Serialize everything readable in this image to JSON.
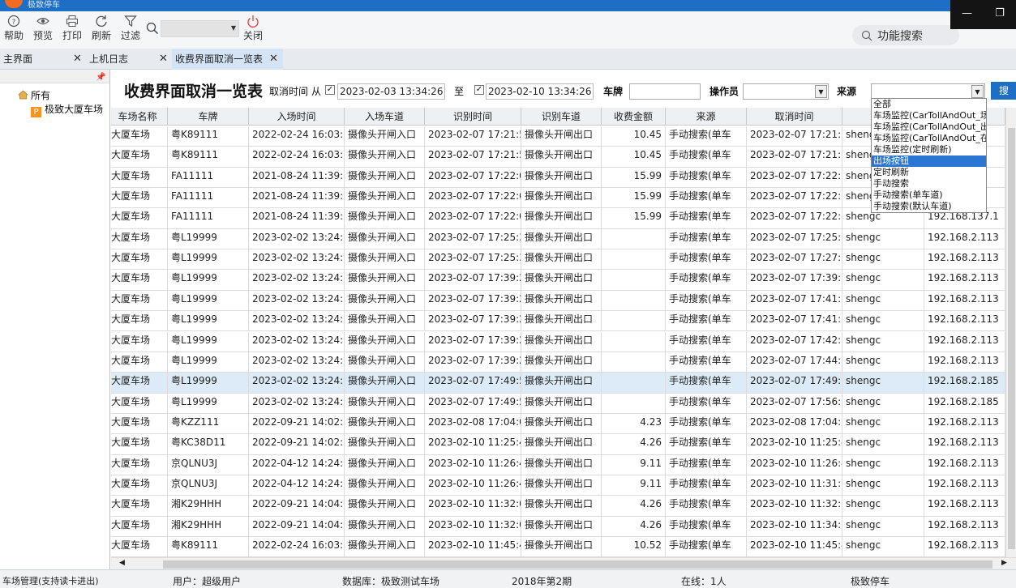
{
  "window": {
    "title": "极致停车"
  },
  "toolbar": {
    "help": "帮助",
    "preview": "预览",
    "print": "打印",
    "refresh": "刷新",
    "filter": "过滤",
    "close": "关闭",
    "function_search": "功能搜索"
  },
  "tabs": [
    {
      "label": "主界面"
    },
    {
      "label": "上机日志"
    },
    {
      "label": "收费界面取消一览表"
    }
  ],
  "tree": {
    "root": "所有",
    "child": "极致大厦车场"
  },
  "page_title": "收费界面取消一览表",
  "filters": {
    "cancel_time_label": "取消时间",
    "from_label": "从",
    "from_value": "2023-02-03 13:34:26",
    "to_label": "至",
    "to_value": "2023-02-10 13:34:26",
    "plate_label": "车牌",
    "operator_label": "操作员",
    "source_label": "来源",
    "query_button": "搜"
  },
  "columns": [
    "车场名称",
    "车牌",
    "入场时间",
    "入场车道",
    "识别时间",
    "识别车道",
    "收费金额",
    "来源",
    "取消时间",
    "",
    ""
  ],
  "rows": [
    [
      "大厦车场",
      "粤K89111",
      "2022-02-24 16:03:5",
      "摄像头开闸入口",
      "2023-02-07 17:21:5",
      "摄像头开闸出口",
      "10.45",
      "手动搜索(单车",
      "2023-02-07 17:21:5",
      "shengc",
      "1"
    ],
    [
      "大厦车场",
      "粤K89111",
      "2022-02-24 16:03:5",
      "摄像头开闸入口",
      "2023-02-07 17:21:5",
      "摄像头开闸出口",
      "10.45",
      "手动搜索(单车",
      "2023-02-07 17:21:5",
      "shengc",
      "1"
    ],
    [
      "大厦车场",
      "FA11111",
      "2021-08-24 11:39:0",
      "摄像头开闸入口",
      "2023-02-07 17:22:0",
      "摄像头开闸出口",
      "15.99",
      "手动搜索(单车",
      "2023-02-07 17:22:0",
      "shengc",
      "1"
    ],
    [
      "大厦车场",
      "FA11111",
      "2021-08-24 11:39:0",
      "摄像头开闸入口",
      "2023-02-07 17:22:0",
      "摄像头开闸出口",
      "15.99",
      "手动搜索(单车",
      "2023-02-07 17:22:0",
      "shengc",
      "1"
    ],
    [
      "大厦车场",
      "FA11111",
      "2021-08-24 11:39:0",
      "摄像头开闸入口",
      "2023-02-07 17:22:0",
      "摄像头开闸出口",
      "15.99",
      "手动搜索(单车",
      "2023-02-07 17:22:0",
      "shengc",
      "192.168.137.1"
    ],
    [
      "大厦车场",
      "粤L19999",
      "2023-02-02 13:24:2",
      "摄像头开闸入口",
      "2023-02-07 17:25:3",
      "摄像头开闸出口",
      "",
      "手动搜索(单车",
      "2023-02-07 17:25:3",
      "shengc",
      "192.168.2.113"
    ],
    [
      "大厦车场",
      "粤L19999",
      "2023-02-02 13:24:2",
      "摄像头开闸入口",
      "2023-02-07 17:25:3",
      "摄像头开闸出口",
      "",
      "手动搜索(单车",
      "2023-02-07 17:27:2",
      "shengc",
      "192.168.2.113"
    ],
    [
      "大厦车场",
      "粤L19999",
      "2023-02-02 13:24:2",
      "摄像头开闸入口",
      "2023-02-07 17:39:2",
      "摄像头开闸出口",
      "",
      "手动搜索(单车",
      "2023-02-07 17:39:2",
      "shengc",
      "192.168.2.113"
    ],
    [
      "大厦车场",
      "粤L19999",
      "2023-02-02 13:24:2",
      "摄像头开闸入口",
      "2023-02-07 17:39:2",
      "摄像头开闸出口",
      "",
      "手动搜索(单车",
      "2023-02-07 17:41:1",
      "shengc",
      "192.168.2.113"
    ],
    [
      "大厦车场",
      "粤L19999",
      "2023-02-02 13:24:2",
      "摄像头开闸入口",
      "2023-02-07 17:39:2",
      "摄像头开闸出口",
      "",
      "手动搜索(单车",
      "2023-02-07 17:41:1",
      "shengc",
      "192.168.2.113"
    ],
    [
      "大厦车场",
      "粤L19999",
      "2023-02-02 13:24:2",
      "摄像头开闸入口",
      "2023-02-07 17:39:2",
      "摄像头开闸出口",
      "",
      "手动搜索(单车",
      "2023-02-07 17:42:2",
      "shengc",
      "192.168.2.113"
    ],
    [
      "大厦车场",
      "粤L19999",
      "2023-02-02 13:24:2",
      "摄像头开闸入口",
      "2023-02-07 17:39:2",
      "摄像头开闸出口",
      "",
      "手动搜索(单车",
      "2023-02-07 17:44:1",
      "shengc",
      "192.168.2.113"
    ],
    [
      "大厦车场",
      "粤L19999",
      "2023-02-02 13:24:2",
      "摄像头开闸入口",
      "2023-02-07 17:49:5",
      "摄像头开闸出口",
      "",
      "手动搜索(单车",
      "2023-02-07 17:49:5",
      "shengc",
      "192.168.2.185"
    ],
    [
      "大厦车场",
      "粤L19999",
      "2023-02-02 13:24:2",
      "摄像头开闸入口",
      "2023-02-07 17:49:5",
      "摄像头开闸出口",
      "",
      "手动搜索(单车",
      "2023-02-07 17:56:1",
      "shengc",
      "192.168.2.185"
    ],
    [
      "大厦车场",
      "粤KZZ111",
      "2022-09-21 14:02:3",
      "摄像头开闸入口",
      "2023-02-08 17:04:0",
      "摄像头开闸出口",
      "4.23",
      "手动搜索(单车",
      "2023-02-08 17:04:0",
      "shengc",
      "192.168.2.113"
    ],
    [
      "大厦车场",
      "粤KC38D11",
      "2022-09-21 14:02:3",
      "摄像头开闸入口",
      "2023-02-10 11:25:4",
      "摄像头开闸出口",
      "4.26",
      "手动搜索(单车",
      "2023-02-10 11:25:4",
      "shengc",
      "192.168.2.113"
    ],
    [
      "大厦车场",
      "京QLNU3J",
      "2022-04-12 14:24:5",
      "摄像头开闸入口",
      "2023-02-10 11:26:4",
      "摄像头开闸出口",
      "9.11",
      "手动搜索(单车",
      "2023-02-10 11:26:4",
      "shengc",
      "192.168.2.113"
    ],
    [
      "大厦车场",
      "京QLNU3J",
      "2022-04-12 14:24:5",
      "摄像头开闸入口",
      "2023-02-10 11:26:4",
      "摄像头开闸出口",
      "9.11",
      "手动搜索(单车",
      "2023-02-10 11:31:1",
      "shengc",
      "192.168.2.113"
    ],
    [
      "大厦车场",
      "湘K29HHH",
      "2022-09-21 14:04:0",
      "摄像头开闸入口",
      "2023-02-10 11:32:0",
      "摄像头开闸出口",
      "4.26",
      "手动搜索(单车",
      "2023-02-10 11:32:0",
      "shengc",
      "192.168.2.113"
    ],
    [
      "大厦车场",
      "湘K29HHH",
      "2022-09-21 14:04:0",
      "摄像头开闸入口",
      "2023-02-10 11:32:0",
      "摄像头开闸出口",
      "4.26",
      "手动搜索(单车",
      "2023-02-10 11:34:0",
      "shengc",
      "192.168.2.113"
    ],
    [
      "大厦车场",
      "粤K89111",
      "2022-02-24 16:03:5",
      "摄像头开闸入口",
      "2023-02-10 11:45:4",
      "摄像头开闸出口",
      "10.52",
      "手动搜索(单车",
      "2023-02-10 11:45:4",
      "shengc",
      "192.168.2.113"
    ]
  ],
  "source_options": [
    {
      "label": "全部"
    },
    {
      "label": "车场监控(CarTollAndOut_场"
    },
    {
      "label": "车场监控(CarTollAndOut_出"
    },
    {
      "label": "车场监控(CarTollAndOut_在"
    },
    {
      "label": "车场监控(定时刷新)"
    },
    {
      "label": "出场按钮",
      "highlighted": true
    },
    {
      "label": "定时刷新"
    },
    {
      "label": "手动搜索"
    },
    {
      "label": "手动搜索(单车道)"
    },
    {
      "label": "手动搜索(默认车道)"
    }
  ],
  "status": {
    "left": "车场管理(支持读卡进出)",
    "user": "用户：超级用户",
    "database": "数据库：极致测试车场",
    "period": "2018年第2期",
    "online": "在线：1人",
    "brand": "极致停车"
  },
  "colors": {
    "accent": "#1c6fc4",
    "highlight": "#2b76d2",
    "selected_row": "#dcebf7"
  }
}
